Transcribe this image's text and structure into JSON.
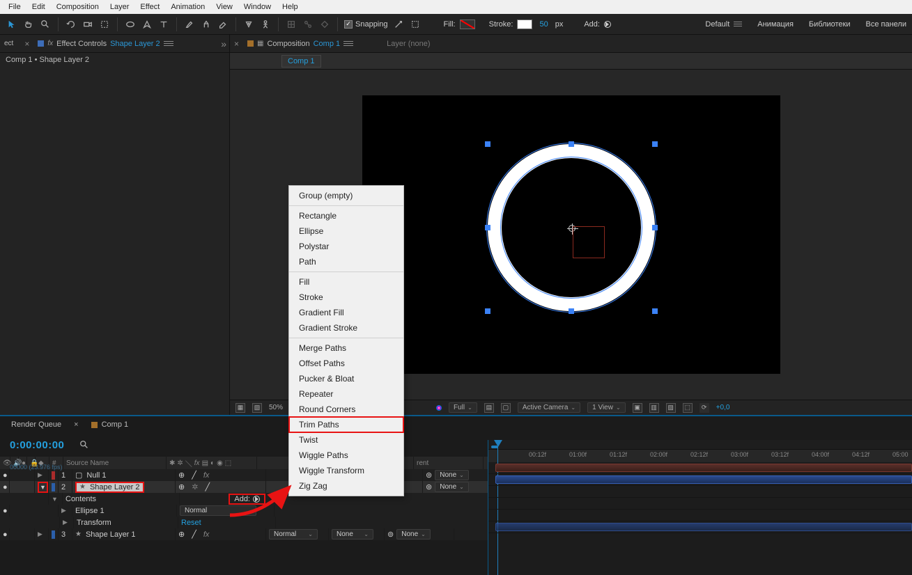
{
  "menu": [
    "File",
    "Edit",
    "Composition",
    "Layer",
    "Effect",
    "Animation",
    "View",
    "Window",
    "Help"
  ],
  "toolbar": {
    "snapping": "Snapping",
    "fill": "Fill:",
    "stroke": "Stroke:",
    "stroke_px": "50",
    "px": "px",
    "add": "Add:",
    "workspaces": [
      "Default",
      "Анимация",
      "Библиотеки",
      "Все панели"
    ]
  },
  "effect_panel": {
    "tab_prefix": "Effect Controls",
    "tab_layer": "Shape Layer 2",
    "breadcrumb": "Comp 1 • Shape Layer 2"
  },
  "comp_panel": {
    "tab_prefix": "Composition",
    "tab_comp": "Comp 1",
    "layer_tab": "Layer (none)",
    "subtab": "Comp 1"
  },
  "viewer_footer": {
    "zoom": "50%",
    "res": "Full",
    "camera": "Active Camera",
    "view": "1 View",
    "exposure": "+0,0"
  },
  "timeline": {
    "tab_renderq": "Render Queue",
    "tab_comp": "Comp 1",
    "timecode": "0:00:00:00",
    "fps": "00000 (23.976 fps)",
    "cols": {
      "num": "#",
      "source": "Source Name"
    },
    "rows": [
      {
        "num": "1",
        "name": "Null 1",
        "chip": "red-chip",
        "mode": "",
        "reset": "",
        "fx": true
      },
      {
        "num": "2",
        "name": "Shape Layer 2",
        "chip": "blue-chip",
        "mode": "",
        "reset": "",
        "fx": false,
        "selected": true
      },
      {
        "contents": "Contents",
        "add": "Add:"
      },
      {
        "child": "Ellipse 1",
        "mode": "Normal"
      },
      {
        "child": "Transform",
        "reset": "Reset"
      },
      {
        "num": "3",
        "name": "Shape Layer 1",
        "chip": "blue-chip",
        "mode": "Normal",
        "parent": "None",
        "fx": true
      }
    ],
    "mode": "Normal",
    "none": "None",
    "parent_col": "rent"
  },
  "ruler_ticks": [
    "00:12f",
    "01:00f",
    "01:12f",
    "02:00f",
    "02:12f",
    "03:00f",
    "03:12f",
    "04:00f",
    "04:12f",
    "05:00"
  ],
  "ctx_menu": {
    "groups": [
      [
        "Group (empty)"
      ],
      [
        "Rectangle",
        "Ellipse",
        "Polystar",
        "Path"
      ],
      [
        "Fill",
        "Stroke",
        "Gradient Fill",
        "Gradient Stroke"
      ],
      [
        "Merge Paths",
        "Offset Paths",
        "Pucker & Bloat",
        "Repeater",
        "Round Corners",
        "Trim Paths",
        "Twist",
        "Wiggle Paths",
        "Wiggle Transform",
        "Zig Zag"
      ]
    ],
    "highlighted": "Trim Paths"
  }
}
